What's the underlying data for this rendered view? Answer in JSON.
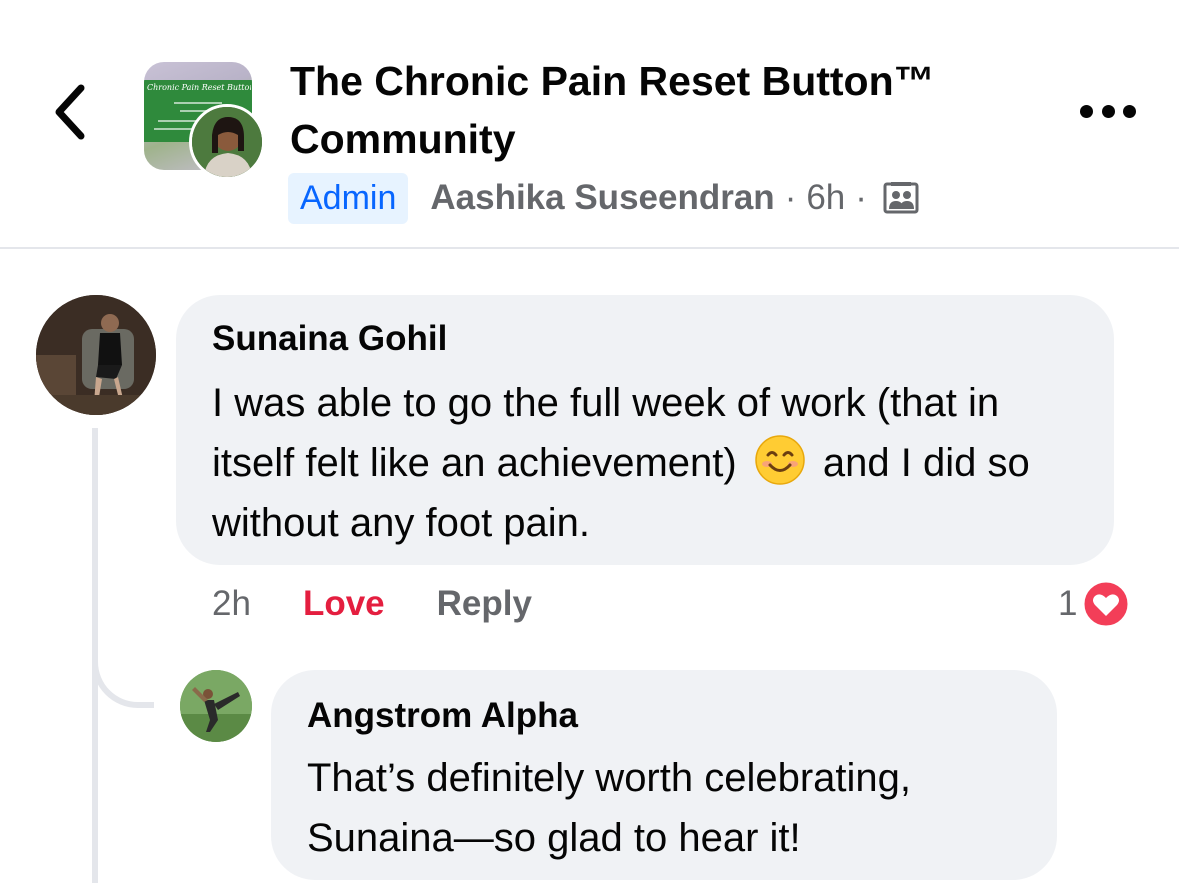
{
  "header": {
    "group_title": "The Chronic Pain Reset Button™ Community",
    "group_thumb_banner_text": "Chronic Pain Reset Button",
    "admin_badge": "Admin",
    "author_name": "Aashika Suseendran",
    "separator": "·",
    "post_time": "6h",
    "back_icon": "chevron-left-icon",
    "more_icon": "more-options-icon",
    "privacy_icon": "group-members-icon"
  },
  "comments": [
    {
      "author": "Sunaina Gohil",
      "text_before_emoji": "I was able to go the full week of work (that in itself felt like an achievement) ",
      "emoji": "smiling-face-icon",
      "text_after_emoji": " and I did so without any foot pain.",
      "time": "2h",
      "love_label": "Love",
      "reply_label": "Reply",
      "reaction_count": "1",
      "reaction_icon": "heart-reaction-icon"
    },
    {
      "author": "Angstrom Alpha",
      "text": "That’s definitely worth celebrating, Sunaina—so glad to hear it!"
    }
  ],
  "colors": {
    "bubble": "#f0f2f5",
    "secondary_text": "#65676b",
    "love_red": "#e41e3f",
    "admin_blue": "#0866ff",
    "admin_bg": "#e7f3ff"
  }
}
